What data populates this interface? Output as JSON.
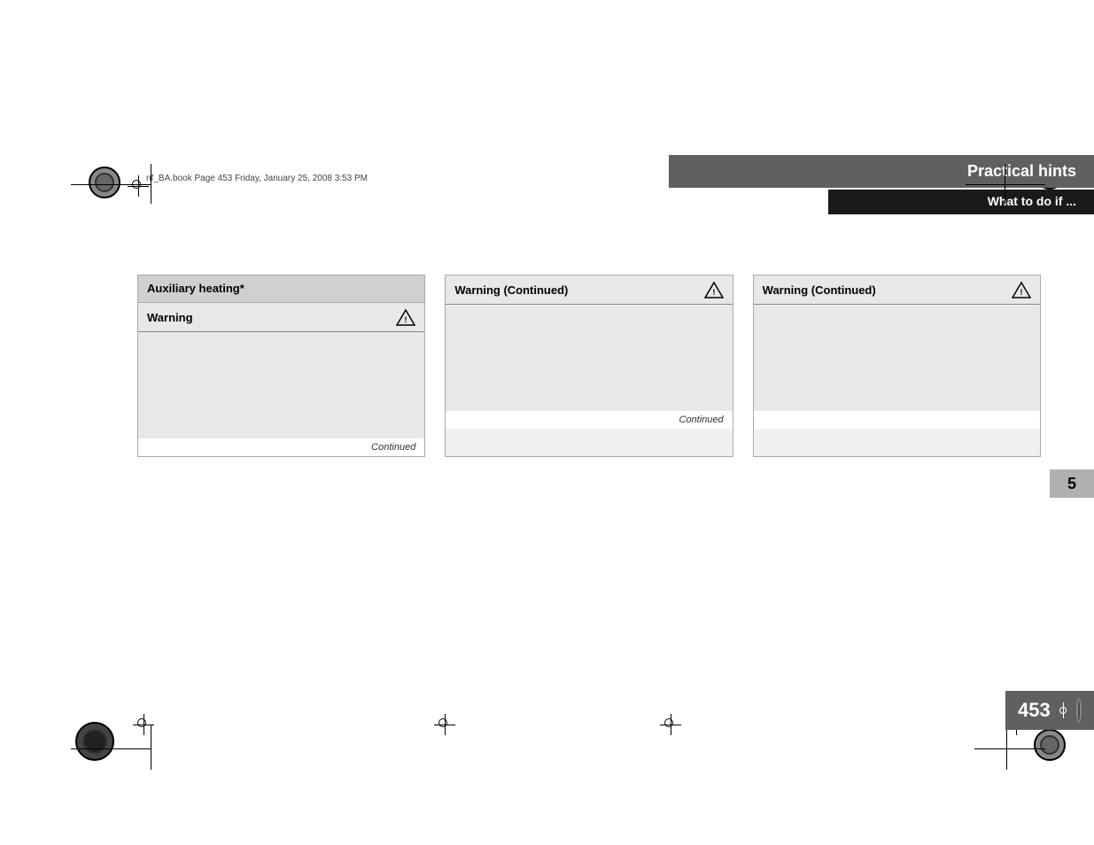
{
  "file_info": {
    "text": "nf_BA.book  Page 453  Friday, January 25, 2008  3:53 PM"
  },
  "header": {
    "practical_hints": "Practical hints",
    "what_to_do": "What to do if ..."
  },
  "columns": [
    {
      "id": "col1",
      "heading": "Auxiliary heating*",
      "subheading": "Warning",
      "body_height": 120,
      "continued": "Continued"
    },
    {
      "id": "col2",
      "heading": null,
      "subheading": "Warning (Continued)",
      "body_height": 120,
      "continued": "Continued"
    },
    {
      "id": "col3",
      "heading": null,
      "subheading": "Warning (Continued)",
      "body_height": 120,
      "continued": null
    }
  ],
  "section_number": "5",
  "page_number": "453",
  "icons": {
    "warning": "⚠",
    "registration_mark": "⊕"
  }
}
